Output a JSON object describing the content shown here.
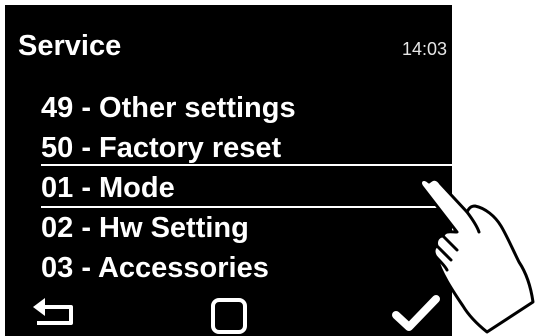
{
  "header": {
    "title": "Service",
    "time": "14:03"
  },
  "menu": {
    "items": [
      {
        "label": "49 - Other settings"
      },
      {
        "label": "50 - Factory reset"
      },
      {
        "label": "01 - Mode",
        "selected": true
      },
      {
        "label": "02 - Hw Setting"
      },
      {
        "label": "03 - Accessories"
      }
    ]
  },
  "footer": {
    "buttons": [
      {
        "icon": "back-arrow-icon"
      },
      {
        "icon": "square-icon"
      },
      {
        "icon": "checkmark-icon"
      }
    ]
  },
  "overlay": {
    "icon": "pointing-hand-icon"
  },
  "colors": {
    "screen_bg": "#000000",
    "text": "#ffffff",
    "page_bg": "#ffffff"
  }
}
